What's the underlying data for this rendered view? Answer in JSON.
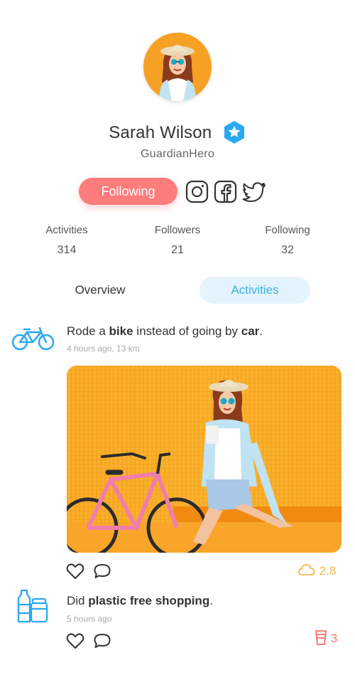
{
  "profile": {
    "name": "Sarah Wilson",
    "username": "GuardianHero"
  },
  "actions": {
    "follow_label": "Following",
    "social_icons": [
      "instagram-icon",
      "facebook-icon",
      "twitter-icon"
    ]
  },
  "stats": [
    {
      "label": "Activities",
      "value": "314"
    },
    {
      "label": "Followers",
      "value": "21"
    },
    {
      "label": "Following",
      "value": "32"
    }
  ],
  "tabs": [
    {
      "label": "Overview",
      "active": false
    },
    {
      "label": "Activities",
      "active": true
    }
  ],
  "activities": [
    {
      "icon": "bike-icon",
      "text_parts": [
        "Rode a ",
        "bike",
        " instead of going by ",
        "car",
        "."
      ],
      "meta": "4 hours ago, 13 km",
      "impact_icon": "cloud-icon",
      "impact_value": "2.8",
      "impact_color": "#f5b94a"
    },
    {
      "icon": "bottles-icon",
      "text_parts": [
        "Did ",
        "plastic free shopping",
        "."
      ],
      "meta": "5 hours ago",
      "impact_icon": "cup-icon",
      "impact_value": "3",
      "impact_color": "#ff6b6b"
    }
  ],
  "colors": {
    "accent_blue": "#3aaee0",
    "follow_button": "#ff7c7c",
    "verified_badge": "#29a9f0",
    "tab_active_bg": "#e3f4fc"
  }
}
